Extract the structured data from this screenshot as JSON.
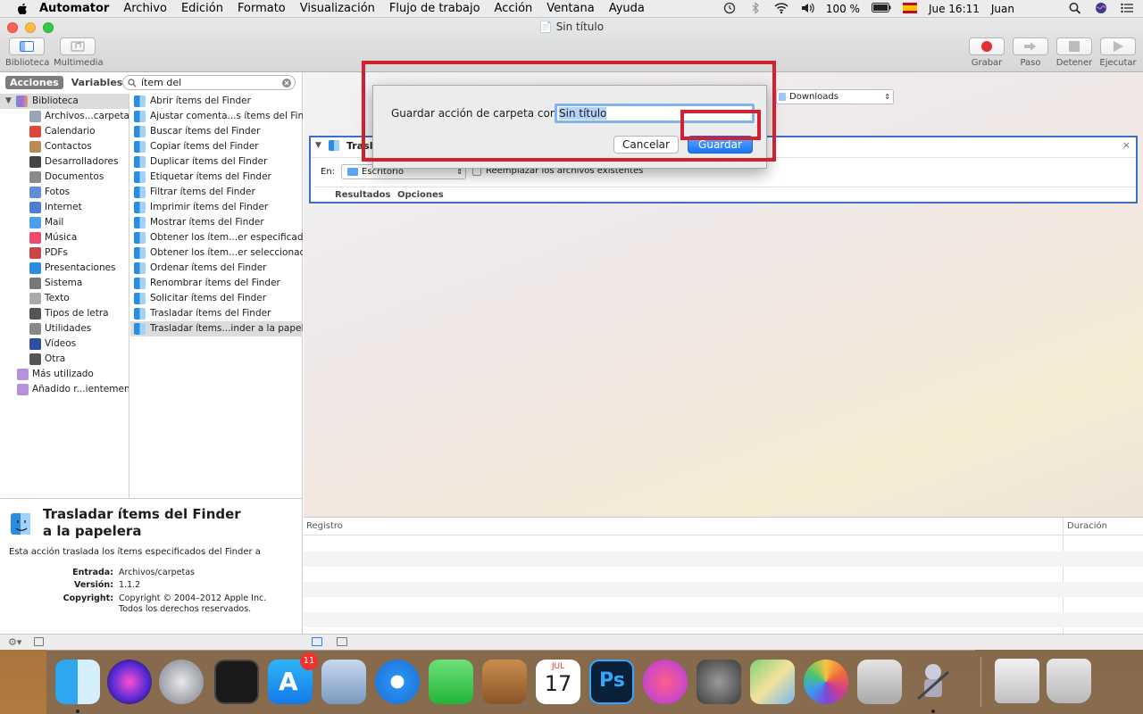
{
  "menubar": {
    "items": [
      "Automator",
      "Archivo",
      "Edición",
      "Formato",
      "Visualización",
      "Flujo de trabajo",
      "Acción",
      "Ventana",
      "Ayuda"
    ],
    "battery": "100 %",
    "clock": "Jue 16:11",
    "user": "Juan"
  },
  "window": {
    "title": "Sin título",
    "toolbar_left": [
      "Biblioteca",
      "Multimedia"
    ],
    "toolbar_right": [
      "Grabar",
      "Paso",
      "Detener",
      "Ejecutar"
    ]
  },
  "library": {
    "tabs": [
      "Acciones",
      "Variables"
    ],
    "search_value": "ítem del",
    "root": "Biblioteca",
    "categories": [
      "Archivos...carpetas",
      "Calendario",
      "Contactos",
      "Desarrolladores",
      "Documentos",
      "Fotos",
      "Internet",
      "Mail",
      "Música",
      "PDFs",
      "Presentaciones",
      "Sistema",
      "Texto",
      "Tipos de letra",
      "Utilidades",
      "Vídeos",
      "Otra"
    ],
    "smart": [
      "Más utilizado",
      "Añadido r...ientemente"
    ]
  },
  "actions": [
    "Abrir ítems del Finder",
    "Ajustar comenta...s ítems del Finder",
    "Buscar ítems del Finder",
    "Copiar ítems del Finder",
    "Duplicar ítems del Finder",
    "Etiquetar ítems del Finder",
    "Filtrar ítems del Finder",
    "Imprimir ítems del Finder",
    "Mostrar ítems del Finder",
    "Obtener los ítem...er especificados",
    "Obtener los ítem...er seleccionados",
    "Ordenar ítems del Finder",
    "Renombrar ítems del Finder",
    "Solicitar ítems del Finder",
    "Trasladar ítems del Finder",
    "Trasladar ítems...inder a la papelera"
  ],
  "info": {
    "title": "Trasladar ítems del Finder a la papelera",
    "description": "Esta acción traslada los ítems especificados del Finder a",
    "input_label": "Entrada:",
    "input_value": "Archivos/carpetas",
    "version_label": "Versión:",
    "version_value": "1.1.2",
    "copyright_label": "Copyright:",
    "copyright_value": "Copyright © 2004–2012 Apple Inc. Todos los derechos reservados."
  },
  "workflow": {
    "folder_select": "Downloads",
    "action_title": "Trasla",
    "in_label": "En:",
    "in_value": "Escritorio",
    "replace_label": "Reemplazar los archivos existentes",
    "tabs": [
      "Resultados",
      "Opciones"
    ]
  },
  "log": {
    "col_log": "Registro",
    "col_duration": "Duración"
  },
  "dialog": {
    "label": "Guardar acción de carpeta como:",
    "name_value": "Sin título",
    "cancel": "Cancelar",
    "save": "Guardar"
  },
  "dock": {
    "badge_appstore": "11",
    "calendar_month": "JUL",
    "calendar_day": "17",
    "ps_label": "Ps"
  }
}
